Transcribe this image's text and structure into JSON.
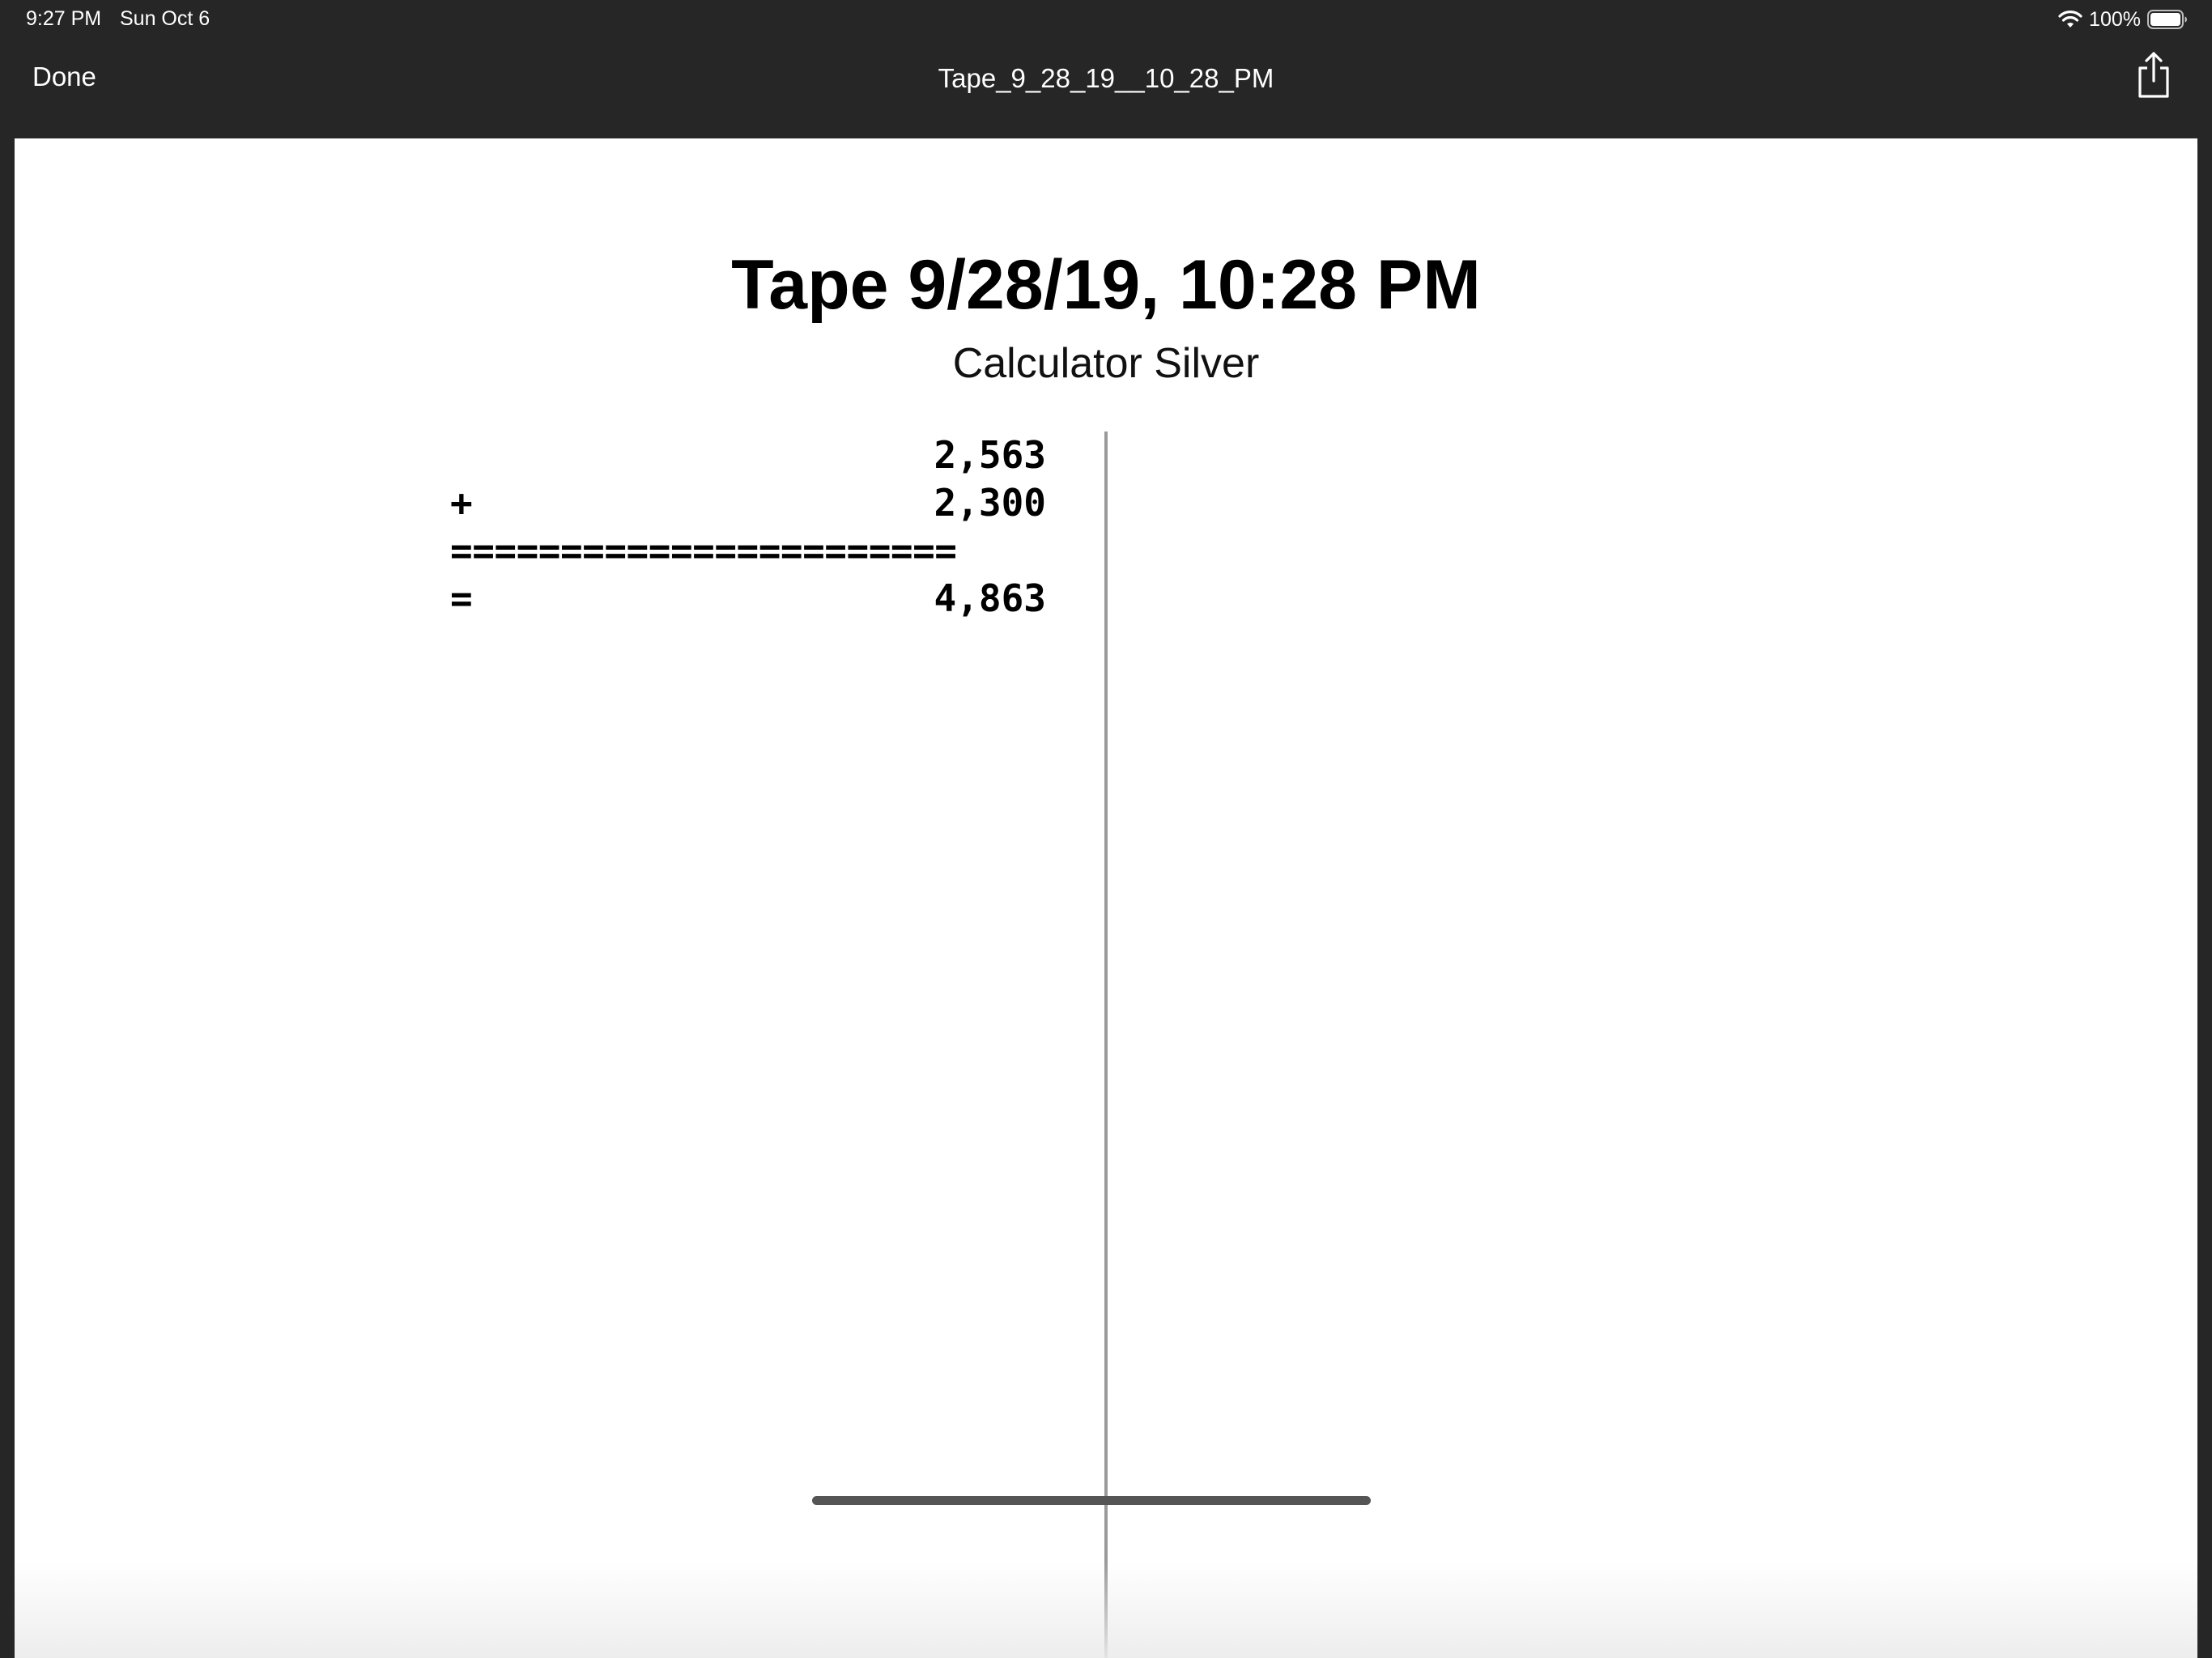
{
  "status_bar": {
    "time": "9:27 PM",
    "date": "Sun Oct 6",
    "battery": "100%",
    "icons": [
      "wifi-icon",
      "battery-icon"
    ]
  },
  "nav": {
    "done_label": "Done",
    "title": "Tape_9_28_19__10_28_PM",
    "share_icon": "share-icon"
  },
  "document": {
    "title": "Tape 9/28/19, 10:28 PM",
    "subtitle": "Calculator Silver",
    "tape": [
      {
        "op": "",
        "value": "2,563"
      },
      {
        "op": "+",
        "value": "2,300"
      },
      {
        "separator": "======================="
      },
      {
        "op": "=",
        "value": "4,863"
      }
    ]
  },
  "colors": {
    "chrome_background": "#262626",
    "page_background": "#ffffff",
    "text": "#000000",
    "divider": "#9a9a9a"
  }
}
